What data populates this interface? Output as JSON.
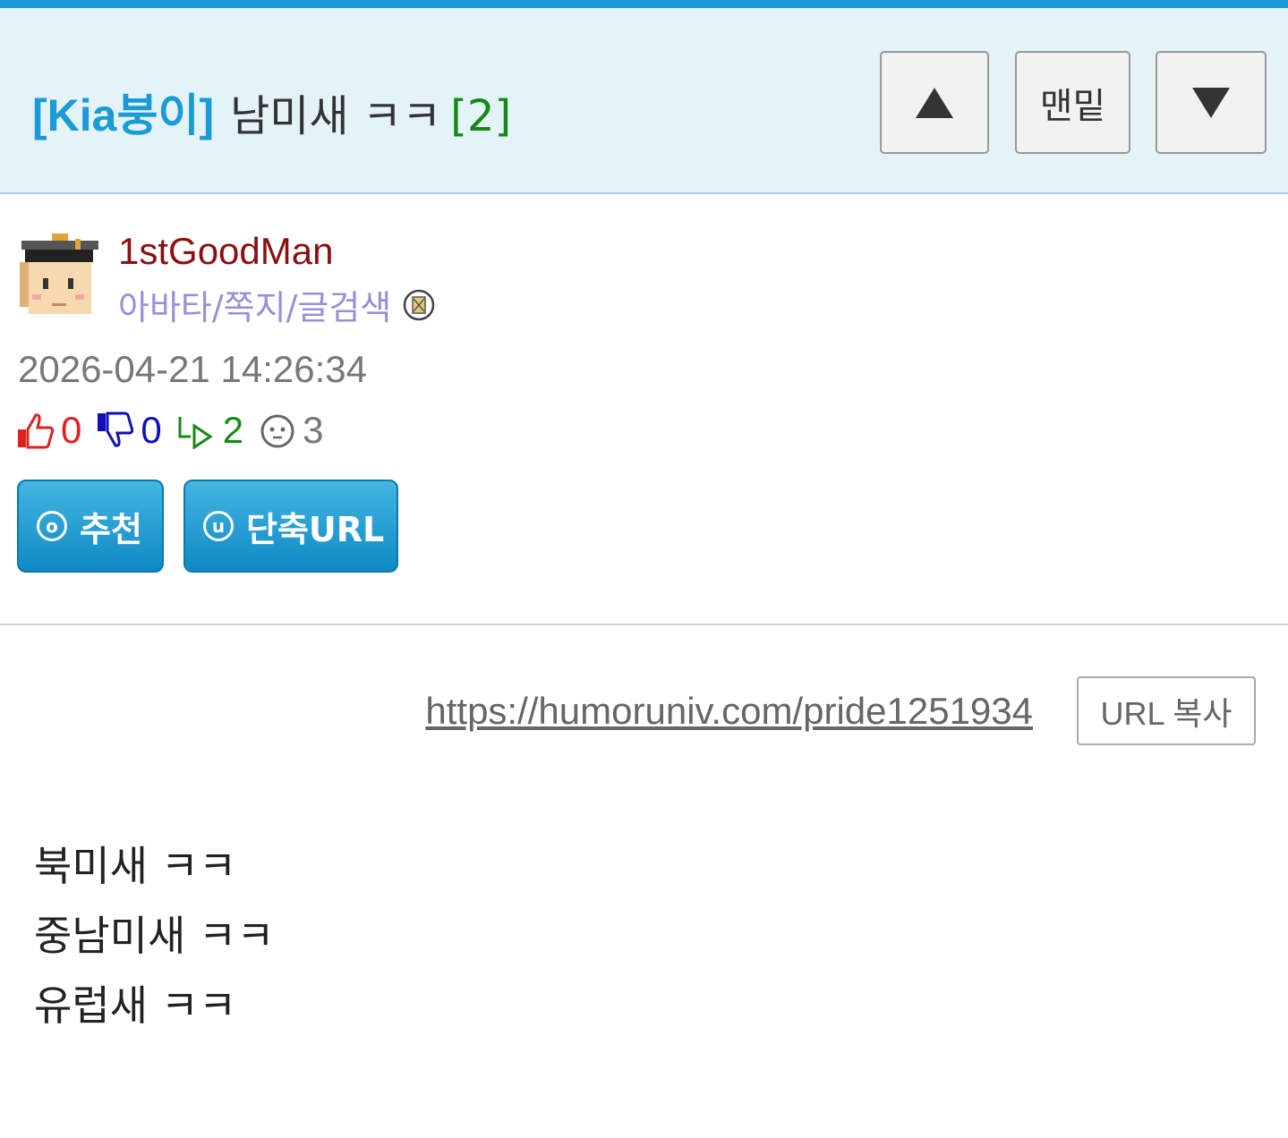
{
  "header": {
    "category": "[Kia붕이]",
    "title": "남미새 ㅋㅋ",
    "comment_count": "[2]",
    "buttons": {
      "up": "▲",
      "bottom": "맨밑",
      "down": "▼"
    }
  },
  "author": {
    "nickname": "1stGoodMan",
    "links": "아바타/쪽지/글검색",
    "avatar_icon": "graduate-avatar-icon",
    "memo_icon": "memo-icon"
  },
  "meta": {
    "date": "2026-04-21 14:26:34",
    "stats": {
      "upvotes": "0",
      "downvotes": "0",
      "replies": "2",
      "views": "3"
    }
  },
  "actions": {
    "recommend": "추천",
    "recommend_icon_glyph": "o",
    "short_url": "단축URL",
    "short_url_icon_glyph": "u"
  },
  "url": {
    "link": "https://humoruniv.com/pride1251934",
    "copy_label": "URL 복사"
  },
  "content": {
    "lines": [
      "북미새 ㅋㅋ",
      "중남미새 ㅋㅋ",
      "유럽새 ㅋㅋ"
    ]
  },
  "colors": {
    "accent": "#1a9ad6",
    "header_bg": "#e4f3f8",
    "comment_count": "#148a14",
    "nickname": "#8b1010",
    "links": "#9a8fd8"
  }
}
